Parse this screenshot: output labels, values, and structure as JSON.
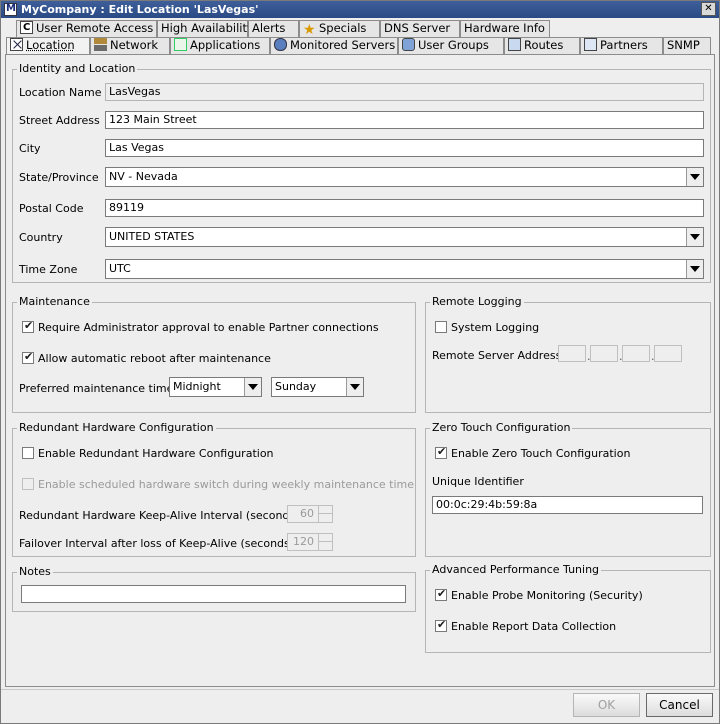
{
  "window": {
    "title": "MyCompany : Edit Location 'LasVegas'",
    "close_glyph": "✕"
  },
  "tabs_row1": [
    {
      "label": "User Remote Access",
      "icon": "c-icon"
    },
    {
      "label": "High Availability"
    },
    {
      "label": "Alerts"
    },
    {
      "label": "Specials",
      "icon": "star-icon"
    },
    {
      "label": "DNS Server"
    },
    {
      "label": "Hardware Info"
    }
  ],
  "tabs_row2": [
    {
      "label": "Location",
      "icon": "location-icon",
      "active": true
    },
    {
      "label": "Network",
      "icon": "network-icon"
    },
    {
      "label": "Applications",
      "icon": "applications-icon"
    },
    {
      "label": "Monitored Servers",
      "icon": "monitored-servers-icon"
    },
    {
      "label": "User Groups",
      "icon": "user-groups-icon"
    },
    {
      "label": "Routes",
      "icon": "routes-icon"
    },
    {
      "label": "Partners",
      "icon": "partners-icon"
    },
    {
      "label": "SNMP"
    }
  ],
  "identity": {
    "legend": "Identity and Location",
    "location_name_label": "Location Name",
    "location_name_value": "LasVegas",
    "street_label": "Street Address",
    "street_value": "123 Main Street",
    "city_label": "City",
    "city_value": "Las Vegas",
    "state_label": "State/Province",
    "state_value": "NV - Nevada",
    "postal_label": "Postal Code",
    "postal_value": "89119",
    "country_label": "Country",
    "country_value": "UNITED STATES",
    "timezone_label": "Time Zone",
    "timezone_value": "UTC"
  },
  "maintenance": {
    "legend": "Maintenance",
    "require_approval_label": "Require Administrator approval to enable Partner connections",
    "require_approval_checked": true,
    "auto_reboot_label": "Allow automatic reboot after maintenance",
    "auto_reboot_checked": true,
    "preferred_time_label": "Preferred maintenance time",
    "time_value": "Midnight",
    "day_value": "Sunday"
  },
  "remote_logging": {
    "legend": "Remote Logging",
    "system_logging_label": "System Logging",
    "system_logging_checked": false,
    "remote_server_label": "Remote Server Address",
    "ip_dot": "."
  },
  "redundant": {
    "legend": "Redundant Hardware Configuration",
    "enable_label": "Enable Redundant Hardware Configuration",
    "enable_checked": false,
    "scheduled_label": "Enable scheduled hardware switch during weekly maintenance time",
    "scheduled_checked": false,
    "keepalive_label": "Redundant Hardware Keep-Alive Interval (seconds)",
    "keepalive_value": "60",
    "failover_label": "Failover Interval after loss of Keep-Alive (seconds)",
    "failover_value": "120"
  },
  "zero_touch": {
    "legend": "Zero Touch Configuration",
    "enable_label": "Enable Zero Touch Configuration",
    "enable_checked": true,
    "unique_id_label": "Unique Identifier",
    "unique_id_value": "00:0c:29:4b:59:8a"
  },
  "notes": {
    "legend": "Notes",
    "value": ""
  },
  "advanced": {
    "legend": "Advanced Performance Tuning",
    "probe_label": "Enable Probe Monitoring (Security)",
    "probe_checked": true,
    "report_label": "Enable Report Data Collection",
    "report_checked": true
  },
  "buttons": {
    "ok_label": "OK",
    "cancel_label": "Cancel"
  }
}
